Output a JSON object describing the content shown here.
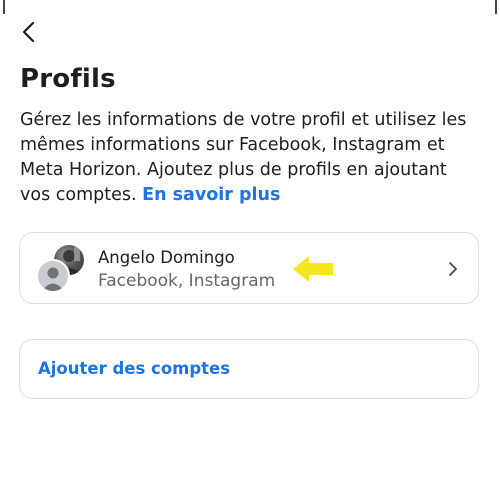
{
  "header": {
    "back_icon": "chevron-left-icon",
    "title": "Profils"
  },
  "description": {
    "text": "Gérez les informations de votre profil et utilisez les mêmes informations sur Facebook, Instagram et Meta Horizon. Ajoutez plus de profils en ajoutant vos comptes.",
    "link_label": "En savoir plus",
    "link_color": "#1b74e4"
  },
  "account": {
    "name": "Angelo Domingo",
    "services": "Facebook, Instagram",
    "chevron_icon": "chevron-right-icon",
    "annotation_icon": "yellow-arrow-left-icon",
    "annotation_color": "#f5e71c"
  },
  "add_accounts": {
    "label": "Ajouter des comptes"
  }
}
